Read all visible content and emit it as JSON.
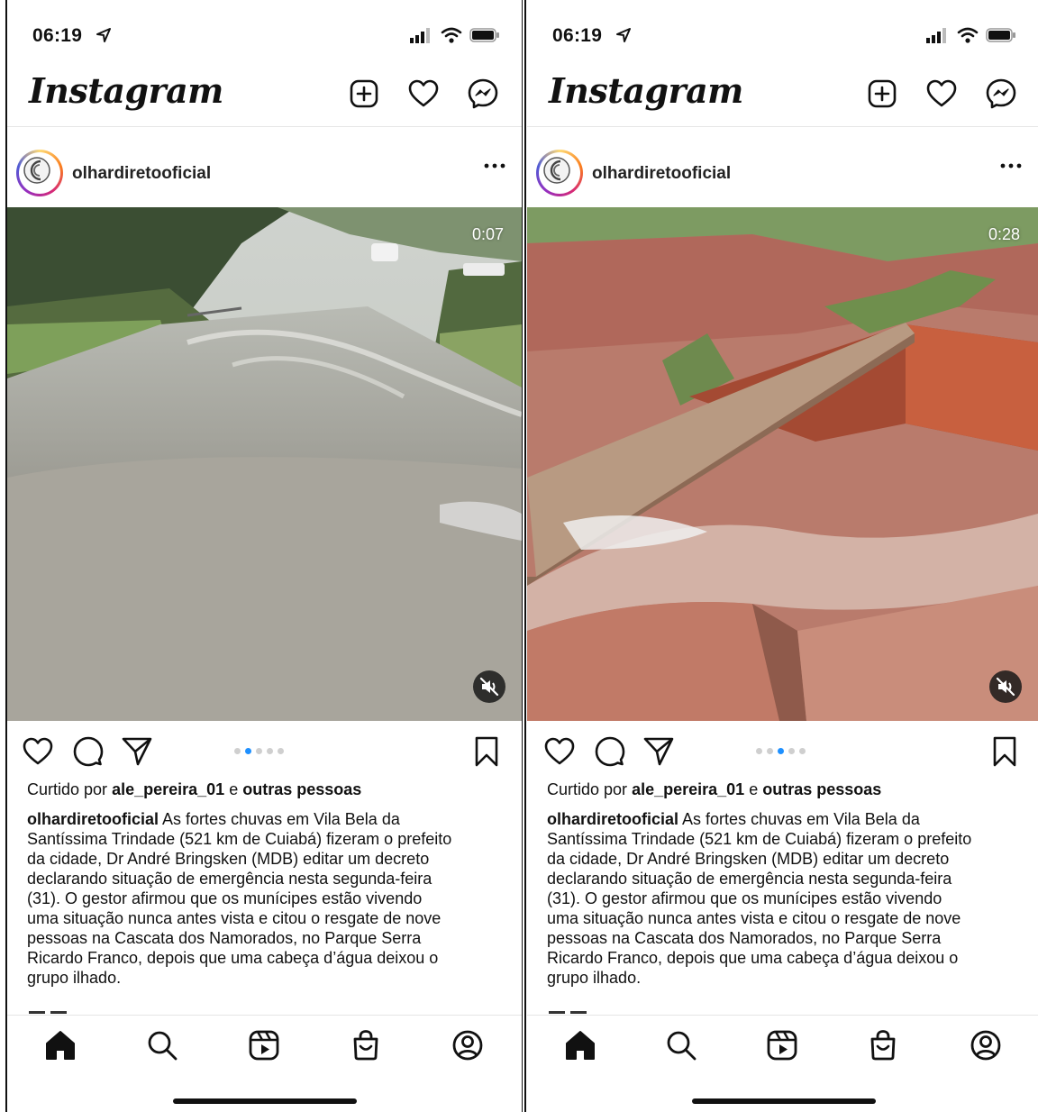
{
  "screens": [
    {
      "status": {
        "time": "06:19"
      },
      "app": {
        "logo": "Instagram"
      },
      "post": {
        "username": "olhardiretooficial",
        "video_duration": "0:07",
        "carousel": {
          "total": 5,
          "active_index": 1
        },
        "liked_by_prefix": "Curtido por",
        "liked_by_user": "ale_pereira_01",
        "liked_by_and": "e",
        "liked_by_others": "outras pessoas",
        "caption_user": "olhardiretooficial",
        "caption_lines": [
          " As fortes chuvas em Vila Bela da",
          "Santíssima Trindade (521 km de Cuiabá) fizeram o prefeito",
          "da cidade, Dr André Bringsken (MDB) editar um decreto",
          "declarando situação de emergência nesta segunda-feira",
          "(31). O gestor afirmou que os munícipes estão vivendo",
          "uma situação nunca antes vista e citou o resgate de nove",
          "pessoas na Cascata dos Namorados, no Parque Serra",
          "Ricardo Franco, depois que uma cabeça d’água deixou o",
          "grupo ilhado."
        ]
      },
      "icons": {
        "header": [
          "new-post-icon",
          "heart-icon",
          "messenger-icon"
        ],
        "actions": [
          "like-icon",
          "comment-icon",
          "share-icon",
          "bookmark-icon"
        ],
        "tabbar": [
          "home-icon",
          "search-icon",
          "reels-icon",
          "shop-icon",
          "profile-icon"
        ]
      },
      "colors": {
        "active_dot": "#1e90ff",
        "text": "#111111"
      }
    },
    {
      "status": {
        "time": "06:19"
      },
      "app": {
        "logo": "Instagram"
      },
      "post": {
        "username": "olhardiretooficial",
        "video_duration": "0:28",
        "carousel": {
          "total": 5,
          "active_index": 2
        },
        "liked_by_prefix": "Curtido por",
        "liked_by_user": "ale_pereira_01",
        "liked_by_and": "e",
        "liked_by_others": "outras pessoas",
        "caption_user": "olhardiretooficial",
        "caption_lines": [
          " As fortes chuvas em Vila Bela da",
          "Santíssima Trindade (521 km de Cuiabá) fizeram o prefeito",
          "da cidade, Dr André Bringsken (MDB) editar um decreto",
          "declarando situação de emergência nesta segunda-feira",
          "(31). O gestor afirmou que os munícipes estão vivendo",
          "uma situação nunca antes vista e citou o resgate de nove",
          "pessoas na Cascata dos Namorados, no Parque Serra",
          "Ricardo Franco, depois que uma cabeça d’água deixou o",
          "grupo ilhado."
        ]
      },
      "icons": {
        "header": [
          "new-post-icon",
          "heart-icon",
          "messenger-icon"
        ],
        "actions": [
          "like-icon",
          "comment-icon",
          "share-icon",
          "bookmark-icon"
        ],
        "tabbar": [
          "home-icon",
          "search-icon",
          "reels-icon",
          "shop-icon",
          "profile-icon"
        ]
      },
      "colors": {
        "active_dot": "#1e90ff",
        "text": "#111111"
      }
    }
  ]
}
